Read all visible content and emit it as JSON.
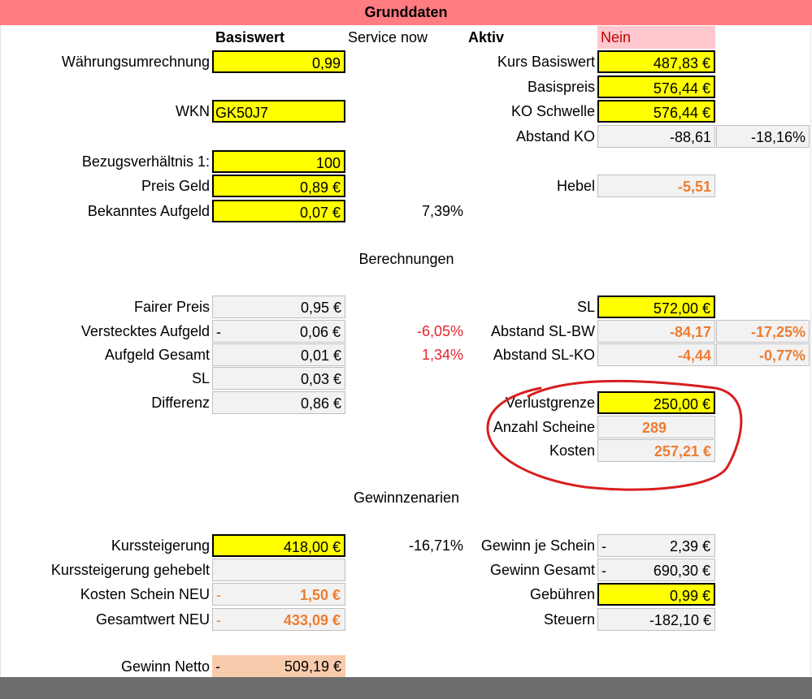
{
  "header": {
    "title": "Grunddaten"
  },
  "top": {
    "basiswert_label": "Basiswert",
    "service_label": "Service now",
    "aktiv_label": "Aktiv",
    "aktiv_value": "Nein"
  },
  "left": {
    "waehrung_label": "Währungsumrechnung",
    "waehrung_value": "0,99",
    "wkn_label": "WKN",
    "wkn_value": "GK50J7",
    "bezug_label": "Bezugsverhältnis 1:",
    "bezug_value": "100",
    "preis_label": "Preis Geld",
    "preis_value": "0,89 €",
    "aufgeld_label": "Bekanntes Aufgeld",
    "aufgeld_value": "0,07 €",
    "aufgeld_pct": "7,39%"
  },
  "right": {
    "kurs_label": "Kurs Basiswert",
    "kurs_value": "487,83 €",
    "basispreis_label": "Basispreis",
    "basispreis_value": "576,44 €",
    "ko_label": "KO Schwelle",
    "ko_value": "576,44 €",
    "abstand_label": "Abstand KO",
    "abstand_value": "-88,61",
    "abstand_pct": "-18,16%",
    "hebel_label": "Hebel",
    "hebel_value": "-5,51"
  },
  "berechnungen": {
    "section_title": "Berechnungen",
    "fair_label": "Fairer Preis",
    "fair_value": "0,95 €",
    "versteckt_label": "Verstecktes Aufgeld",
    "versteckt_prefix": "-",
    "versteckt_value": "0,06 €",
    "versteckt_pct": "-6,05%",
    "gesamt_label": "Aufgeld Gesamt",
    "gesamt_value": "0,01 €",
    "gesamt_pct": "1,34%",
    "sl_label": "SL",
    "sl_value": "0,03 €",
    "diff_label": "Differenz",
    "diff_value": "0,86 €",
    "sl_r_label": "SL",
    "sl_r_value": "572,00 €",
    "slbw_label": "Abstand SL-BW",
    "slbw_value": "-84,17",
    "slbw_pct": "-17,25%",
    "slko_label": "Abstand SL-KO",
    "slko_value": "-4,44",
    "slko_pct": "-0,77%",
    "verlust_label": "Verlustgrenze",
    "verlust_value": "250,00 €",
    "anzahl_label": "Anzahl Scheine",
    "anzahl_value": "289",
    "kosten_label": "Kosten",
    "kosten_value": "257,21 €"
  },
  "gewinn": {
    "section_title": "Gewinnzenarien",
    "kurs_label": "Kurssteigerung",
    "kurs_value": "418,00 €",
    "kurs_pct": "-16,71%",
    "gehebelt_label": "Kurssteigerung gehebelt",
    "kosten_neu_label": "Kosten Schein NEU",
    "kosten_neu_prefix": "-",
    "kosten_neu_value": "1,50 €",
    "gesamtwert_label": "Gesamtwert NEU",
    "gesamtwert_prefix": "-",
    "gesamtwert_value": "433,09 €",
    "netto_label": "Gewinn Netto",
    "netto_prefix": "-",
    "netto_value": "509,19 €",
    "je_schein_label": "Gewinn je Schein",
    "je_schein_prefix": "-",
    "je_schein_value": "2,39 €",
    "gesamt_label": "Gewinn Gesamt",
    "gesamt_prefix": "-",
    "gesamt_value": "690,30 €",
    "gebuehren_label": "Gebühren",
    "gebuehren_value": "0,99 €",
    "steuern_label": "Steuern",
    "steuern_value": "-182,10 €"
  },
  "colors": {
    "banner": "#ff7c80",
    "input_yellow": "#ffff00",
    "computed_gray": "#f2f2f2",
    "accent_orange": "#ed7d31",
    "negative_red": "#e8232d",
    "annotation_red": "#d81e1e"
  }
}
